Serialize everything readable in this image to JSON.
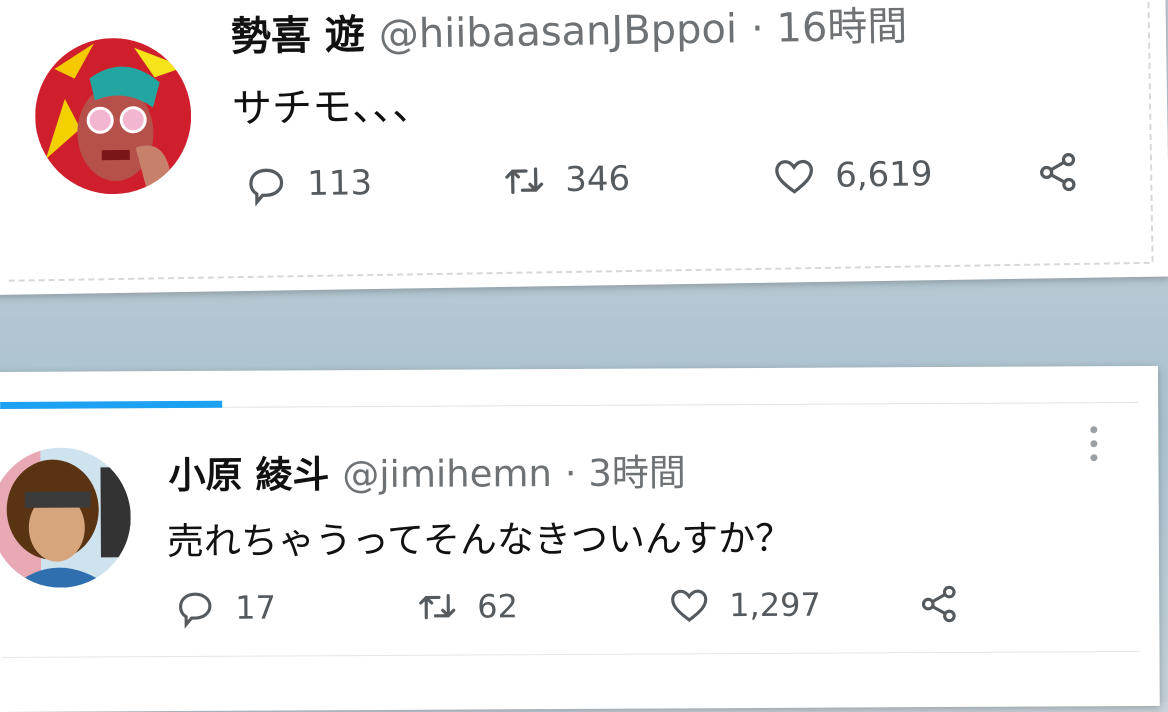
{
  "tweets": [
    {
      "name": "勢喜 遊",
      "handle": "@hiibaasanJBppoi",
      "time": "· 16時間",
      "text": "サチモ、、、",
      "replies": "113",
      "retweets": "346",
      "likes": "6,619"
    },
    {
      "name": "小原 綾斗",
      "handle": "@jimihemn",
      "time": "· 3時間",
      "text": "売れちゃうってそんなきついんすか？",
      "replies": "17",
      "retweets": "62",
      "likes": "1,297"
    }
  ],
  "icons": [
    "reply-icon",
    "retweet-icon",
    "like-icon",
    "share-icon",
    "more-icon"
  ],
  "colors": {
    "accent": "#1da1f2",
    "icon": "#555a5e"
  }
}
